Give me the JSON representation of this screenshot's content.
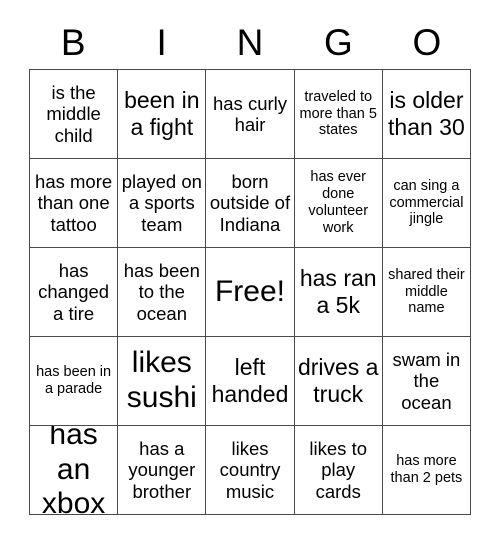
{
  "header": {
    "letters": [
      "B",
      "I",
      "N",
      "G",
      "O"
    ]
  },
  "grid": {
    "rows": [
      [
        {
          "text": "is the middle child",
          "size": "md"
        },
        {
          "text": "been in a fight",
          "size": "lg"
        },
        {
          "text": "has curly hair",
          "size": "md"
        },
        {
          "text": "traveled to more than 5 states",
          "size": "sm"
        },
        {
          "text": "is older than 30",
          "size": "lg"
        }
      ],
      [
        {
          "text": "has more than one tattoo",
          "size": "md"
        },
        {
          "text": "played on a sports team",
          "size": "md"
        },
        {
          "text": "born outside of Indiana",
          "size": "md"
        },
        {
          "text": "has ever done volunteer work",
          "size": "sm"
        },
        {
          "text": "can sing a commercial jingle",
          "size": "sm"
        }
      ],
      [
        {
          "text": "has changed a tire",
          "size": "md"
        },
        {
          "text": "has been to the ocean",
          "size": "md"
        },
        {
          "text": "Free!",
          "size": "xl"
        },
        {
          "text": "has ran a 5k",
          "size": "lg"
        },
        {
          "text": "shared their middle name",
          "size": "sm"
        }
      ],
      [
        {
          "text": "has been in a parade",
          "size": "sm"
        },
        {
          "text": "likes sushi",
          "size": "xl"
        },
        {
          "text": "left handed",
          "size": "lg"
        },
        {
          "text": "drives a truck",
          "size": "lg"
        },
        {
          "text": "swam in the ocean",
          "size": "md"
        }
      ],
      [
        {
          "text": "has an xbox",
          "size": "xl"
        },
        {
          "text": "has a younger brother",
          "size": "md"
        },
        {
          "text": "likes country music",
          "size": "md"
        },
        {
          "text": "likes to play cards",
          "size": "md"
        },
        {
          "text": "has more than 2 pets",
          "size": "sm"
        }
      ]
    ]
  },
  "colors": {
    "background": "#ffffff",
    "text": "#000000",
    "grid_line": "#4a4a4a"
  }
}
